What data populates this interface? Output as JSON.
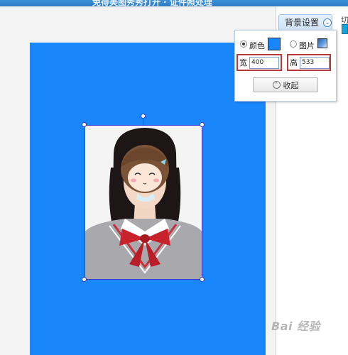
{
  "app": {
    "title": "免得美图秀秀打开 · 证件照处理"
  },
  "background_panel": {
    "tab_label": "背景设置",
    "color_option_label": "颜色",
    "image_option_label": "图片",
    "selected_option": "颜色",
    "color_swatch": "#1a86fb",
    "width_label": "宽",
    "width_value": "400",
    "height_label": "高",
    "height_value": "533",
    "collapse_label": "收起"
  },
  "right_side": {
    "cut_label": "切"
  },
  "canvas": {
    "background_color": "#1a86fb"
  },
  "watermark": {
    "text": "Bai 经验"
  },
  "colors": {
    "accent": "#1a86fb",
    "highlight_border": "#b83a3a",
    "selection": "#3a3ad6"
  }
}
